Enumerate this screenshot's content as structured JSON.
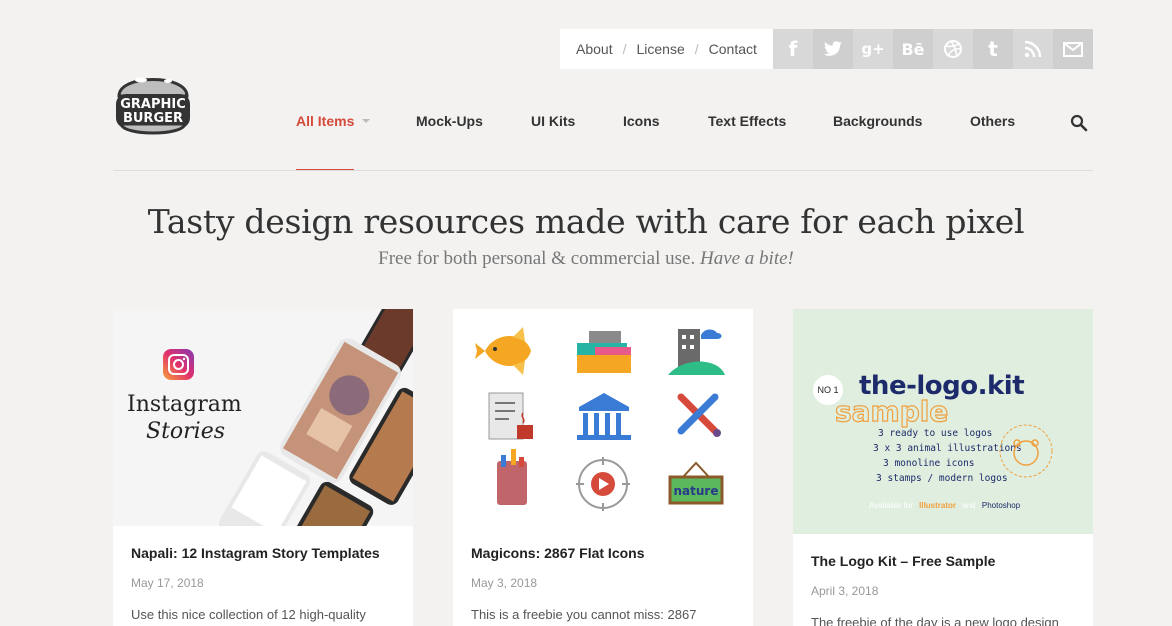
{
  "toplinks": {
    "about": "About",
    "license": "License",
    "contact": "Contact",
    "sep": "/"
  },
  "social": [
    {
      "icon": "facebook-icon",
      "glyph": "f"
    },
    {
      "icon": "twitter-icon",
      "glyph": "t"
    },
    {
      "icon": "google-plus-icon",
      "glyph": "g+"
    },
    {
      "icon": "behance-icon",
      "glyph": "Bē"
    },
    {
      "icon": "dribbble-icon",
      "glyph": "◎"
    },
    {
      "icon": "tumblr-icon",
      "glyph": "t"
    },
    {
      "icon": "rss-icon",
      "glyph": "≋"
    },
    {
      "icon": "mail-icon",
      "glyph": "✉"
    }
  ],
  "logo": {
    "line1": "GRAPHIC",
    "line2": "BURGER"
  },
  "nav": {
    "all": "All Items",
    "mockups": "Mock-Ups",
    "uikits": "UI Kits",
    "icons": "Icons",
    "texteffects": "Text Effects",
    "backgrounds": "Backgrounds",
    "others": "Others"
  },
  "hero": {
    "headline": "Tasty design resources made with care for each pixel",
    "sub": "Free for both personal & commercial use.",
    "sub_em": "Have a bite!"
  },
  "cards": [
    {
      "title": "Napali: 12 Instagram Story Templates",
      "date": "May 17, 2018",
      "desc": "Use this nice collection of 12 high-quality",
      "thumb": {
        "line1": "Instagram",
        "line2": "Stories"
      }
    },
    {
      "title": "Magicons: 2867 Flat Icons",
      "date": "May 3, 2018",
      "desc": "This is a freebie you cannot miss: 2867",
      "thumb": {
        "sign": "nature"
      }
    },
    {
      "title": "The Logo Kit – Free Sample",
      "date": "April 3, 2018",
      "desc": "The freebie of the day is a new logo design",
      "thumb": {
        "badge": "NO 1",
        "brand": "the-logo.kit",
        "sample": "sample",
        "items": [
          "3 ready to use logos",
          "3 x 3 animal illustrations",
          "3 monoline icons",
          "3 stamps / modern logos"
        ],
        "avail": "Available for",
        "illustrator": "Illustrator",
        "and": "and",
        "photoshop": "Photoshop"
      }
    }
  ],
  "colors": {
    "accent": "#d64a3b",
    "background": "#f3f2f1"
  }
}
